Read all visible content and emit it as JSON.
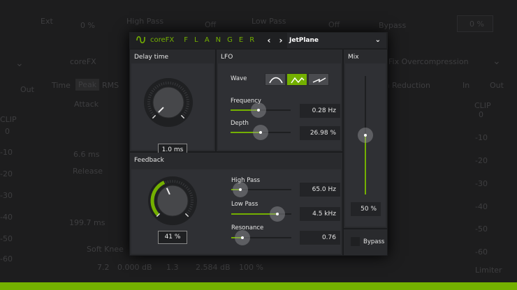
{
  "background": {
    "top": [
      "Ext",
      "0 %",
      "High Pass",
      "Off",
      "Low Pass",
      "Off",
      "Bypass",
      "0 %"
    ],
    "left": {
      "brand": "coreFX",
      "time": "Time",
      "peak": "Peak",
      "rms": "RMS",
      "attack": "Attack",
      "attack_val": "6.6 ms",
      "release": "Release",
      "release_val": "199.7 ms",
      "soft_knee": "Soft Knee",
      "out": "Out",
      "clip": "CLIP",
      "scale": [
        "0",
        "-10",
        "-20",
        "-30",
        "-40",
        "-50",
        "-60"
      ]
    },
    "bottom": [
      "7.2",
      "0.000 dB",
      "1.3",
      "2.584 dB",
      "100 %"
    ],
    "right": {
      "preset": "Fix Overcompression",
      "gain_reduction": "Gain Reduction",
      "in": "In",
      "out": "Out",
      "clip": "CLIP",
      "scale": [
        "0",
        "-10",
        "-20",
        "-30",
        "-40",
        "-50",
        "-60"
      ],
      "limiter": "Limiter"
    }
  },
  "plugin": {
    "brand": "coreFX",
    "name": "FLANGER",
    "preset": "JetPlane",
    "delay": {
      "title": "Delay time",
      "value": "1.0 ms",
      "level": 0.0
    },
    "lfo": {
      "title": "LFO",
      "wave_label": "Wave",
      "waves": [
        "sine",
        "triangle",
        "sawtooth"
      ],
      "selected_wave": 1,
      "frequency": {
        "label": "Frequency",
        "value": "0.28 Hz",
        "level": 0.47
      },
      "depth": {
        "label": "Depth",
        "value": "26.98 %",
        "level": 0.5
      }
    },
    "mix": {
      "title": "Mix",
      "value": "50 %",
      "level": 0.5
    },
    "feedback": {
      "title": "Feedback",
      "value": "41 %",
      "level": 0.41,
      "high_pass": {
        "label": "High Pass",
        "value": "65.0 Hz",
        "level": 0.15
      },
      "low_pass": {
        "label": "Low Pass",
        "value": "4.5 kHz",
        "level": 0.77
      },
      "resonance": {
        "label": "Resonance",
        "value": "0.76",
        "level": 0.19
      }
    },
    "bypass": {
      "label": "Bypass",
      "checked": false
    }
  },
  "colors": {
    "accent": "#74b000"
  }
}
